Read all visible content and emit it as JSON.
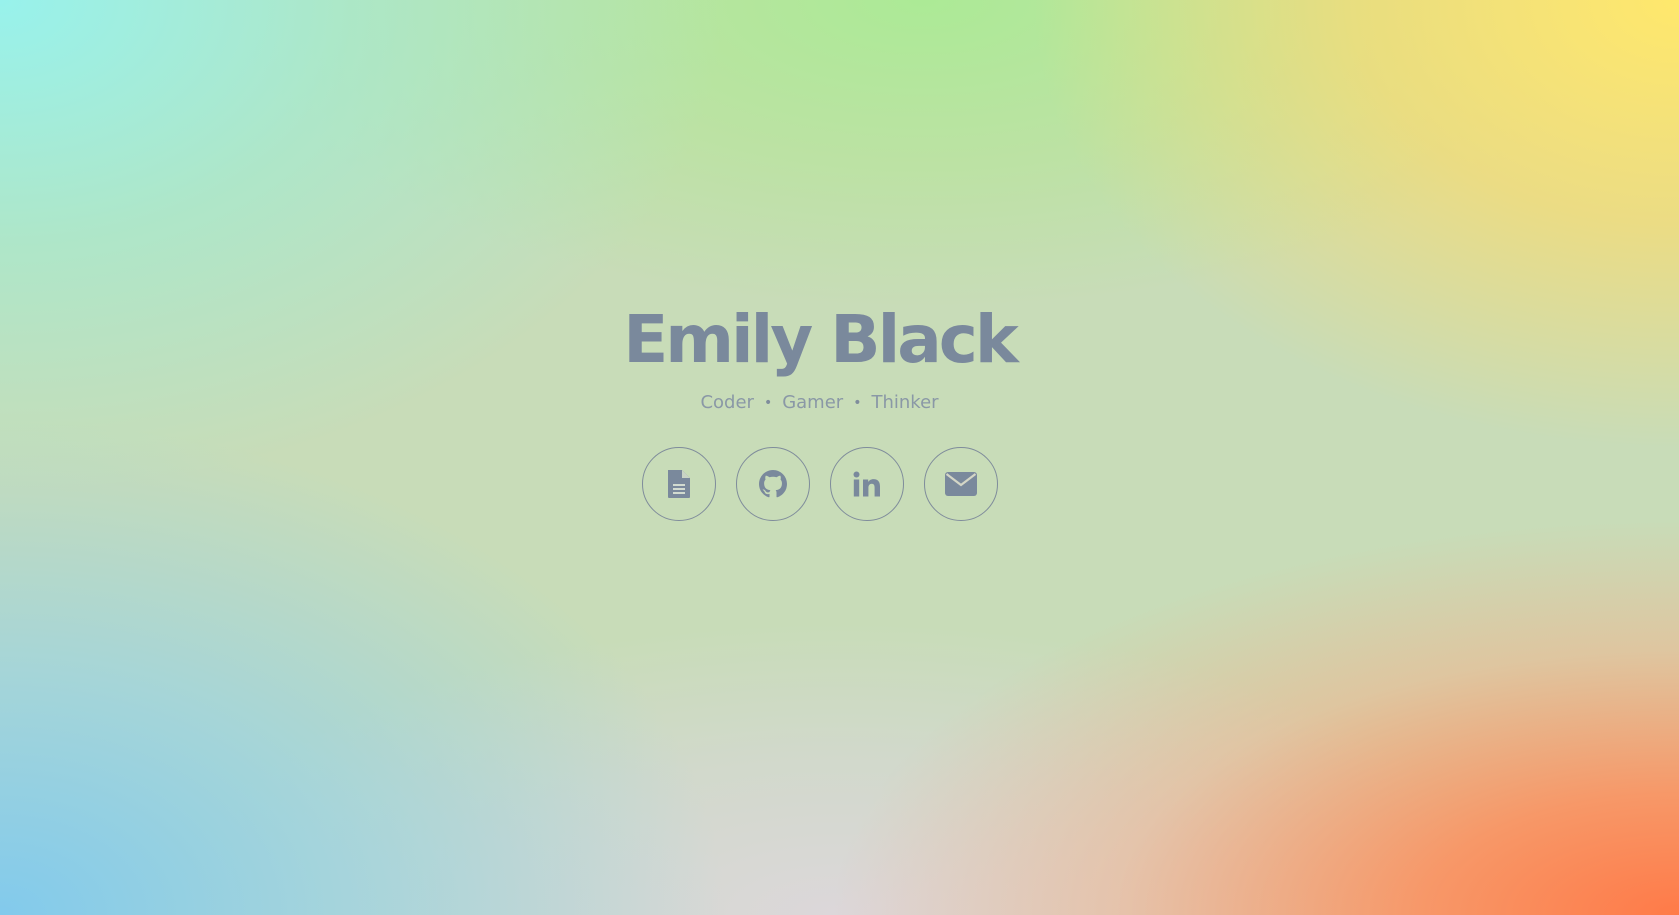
{
  "profile": {
    "name": "Emily Black",
    "tags": [
      "Coder",
      "Gamer",
      "Thinker"
    ],
    "separator": "•"
  },
  "social": [
    {
      "icon": "document-icon",
      "label": "Resume"
    },
    {
      "icon": "github-icon",
      "label": "GitHub"
    },
    {
      "icon": "linkedin-icon",
      "label": "LinkedIn"
    },
    {
      "icon": "envelope-icon",
      "label": "Email"
    }
  ],
  "colors": {
    "text": "#7a899c",
    "tagline": "#8a98a6",
    "border": "#7f8c9b"
  }
}
